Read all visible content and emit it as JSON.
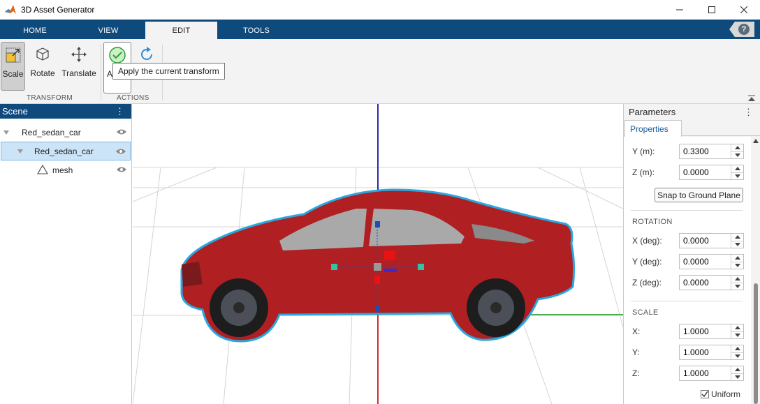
{
  "window": {
    "title": "3D Asset Generator",
    "controls": [
      "minimize",
      "maximize",
      "close"
    ]
  },
  "tabs": [
    {
      "label": "HOME",
      "active": false
    },
    {
      "label": "VIEW",
      "active": false
    },
    {
      "label": "EDIT",
      "active": true
    },
    {
      "label": "TOOLS",
      "active": false
    }
  ],
  "ribbon": {
    "transform_group": "TRANSFORM",
    "actions_group": "ACTIONS",
    "scale_label": "Scale",
    "rotate_label": "Rotate",
    "translate_label": "Translate",
    "apply_label": "A",
    "tooltip": "Apply the current transform"
  },
  "scene": {
    "title": "Scene",
    "menu": "⋮",
    "items": [
      {
        "label": "Red_sedan_car",
        "level": 0,
        "selected": false,
        "visible": true
      },
      {
        "label": "Red_sedan_car",
        "level": 1,
        "selected": true,
        "visible": true
      },
      {
        "label": "mesh",
        "level": 2,
        "selected": false,
        "visible": true
      }
    ]
  },
  "params": {
    "title": "Parameters",
    "menu": "⋮",
    "tab": "Properties",
    "translation": {
      "y_label": "Y (m):",
      "y_value": "0.3300",
      "z_label": "Z (m):",
      "z_value": "0.0000"
    },
    "snap_button": "Snap to Ground Plane",
    "rotation": {
      "header": "ROTATION",
      "x_label": "X (deg):",
      "x_value": "0.0000",
      "y_label": "Y (deg):",
      "y_value": "0.0000",
      "z_label": "Z (deg):",
      "z_value": "0.0000"
    },
    "scale": {
      "header": "SCALE",
      "x_label": "X:",
      "x_value": "1.0000",
      "y_label": "Y:",
      "y_value": "1.0000",
      "z_label": "Z:",
      "z_value": "1.0000",
      "uniform_label": "Uniform",
      "uniform_checked": true
    }
  },
  "colors": {
    "accent": "#0e4a7c",
    "car_body": "#b01f22",
    "selection_outline": "#29a8e0",
    "x_axis": "#d0302d",
    "y_axis": "#4caf50",
    "z_axis": "#2a2aa8"
  }
}
